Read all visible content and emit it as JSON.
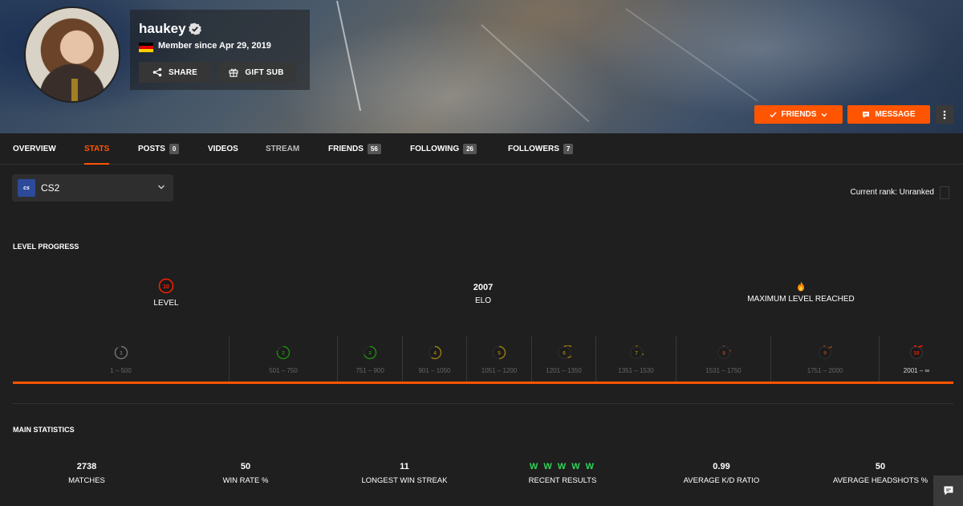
{
  "profile": {
    "username": "haukey",
    "member_since": "Member since Apr 29, 2019",
    "share_label": "SHARE",
    "gift_label": "GIFT SUB",
    "friends_label": "FRIENDS",
    "message_label": "MESSAGE"
  },
  "tabs": [
    {
      "label": "OVERVIEW"
    },
    {
      "label": "STATS",
      "active": true
    },
    {
      "label": "POSTS",
      "count": "0"
    },
    {
      "label": "VIDEOS"
    },
    {
      "label": "STREAM"
    },
    {
      "label": "FRIENDS",
      "count": "56"
    },
    {
      "label": "FOLLOWING",
      "count": "26"
    },
    {
      "label": "FOLLOWERS",
      "count": "7"
    }
  ],
  "game": {
    "logo_text": "cs",
    "name": "CS2"
  },
  "rank": {
    "text": "Current rank: Unranked"
  },
  "level_progress": {
    "title": "LEVEL PROGRESS",
    "level_value": "10",
    "level_label": "LEVEL",
    "elo_value": "2007",
    "elo_label": "ELO",
    "max_label": "MAXIMUM LEVEL REACHED",
    "levels": [
      {
        "n": "1",
        "range": "1 – 500",
        "color": "#bbbbbb"
      },
      {
        "n": "2",
        "range": "501 – 750",
        "color": "#1ce400"
      },
      {
        "n": "3",
        "range": "751 – 900",
        "color": "#1ce400"
      },
      {
        "n": "4",
        "range": "901 – 1050",
        "color": "#ffc800"
      },
      {
        "n": "5",
        "range": "1051 – 1200",
        "color": "#ffc800"
      },
      {
        "n": "6",
        "range": "1201 – 1350",
        "color": "#ffc800"
      },
      {
        "n": "7",
        "range": "1351 – 1530",
        "color": "#ffc800"
      },
      {
        "n": "8",
        "range": "1531 – 1750",
        "color": "#ff6309"
      },
      {
        "n": "9",
        "range": "1751 – 2000",
        "color": "#ff6309"
      },
      {
        "n": "10",
        "range": "2001 – ∞",
        "color": "#fe1f00",
        "current": true
      }
    ]
  },
  "main_stats": {
    "title": "MAIN STATISTICS",
    "items": [
      {
        "value": "2738",
        "label": "MATCHES"
      },
      {
        "value": "50",
        "label": "WIN RATE %"
      },
      {
        "value": "11",
        "label": "LONGEST WIN STREAK"
      },
      {
        "value": "W W W W W",
        "label": "RECENT RESULTS"
      },
      {
        "value": "0.99",
        "label": "AVERAGE K/D RATIO"
      },
      {
        "value": "50",
        "label": "AVERAGE HEADSHOTS %"
      }
    ]
  },
  "colors": {
    "accent": "#ff5500",
    "win": "#32d35a",
    "background": "#1f1f1f"
  }
}
